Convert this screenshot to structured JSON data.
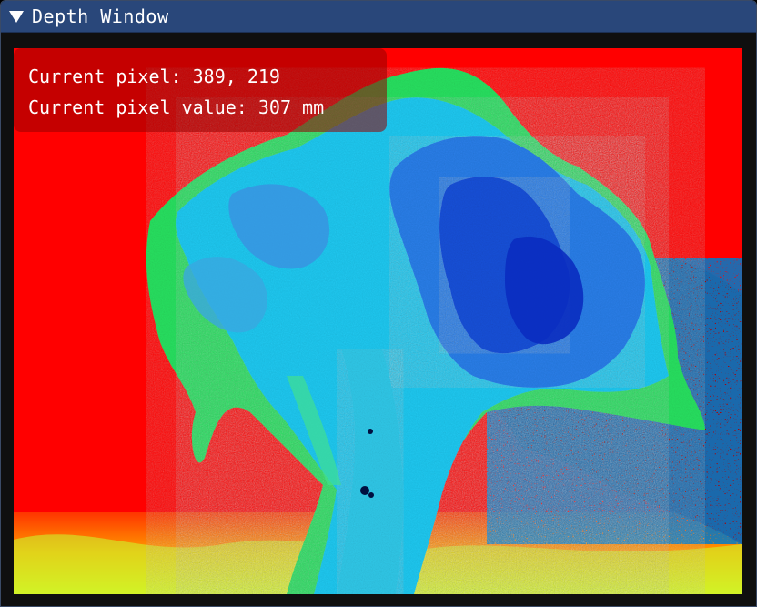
{
  "window": {
    "title": "Depth Window",
    "collapse_icon": "triangle-down-icon",
    "title_bar_color": "#29477a"
  },
  "overlay": {
    "pixel_label": "Current pixel: ",
    "pixel_coords": "389, 219",
    "value_label": "Current pixel value: ",
    "value_number": "307",
    "value_unit": " mm"
  },
  "depth_image": {
    "colormap": "jet",
    "colors": {
      "far_background": "#ff0000",
      "mid_depth": "#00ff66",
      "near_depth": "#1e6ee6",
      "nearest": "#0a28c8",
      "floor_yellow": "#ffe000"
    }
  }
}
